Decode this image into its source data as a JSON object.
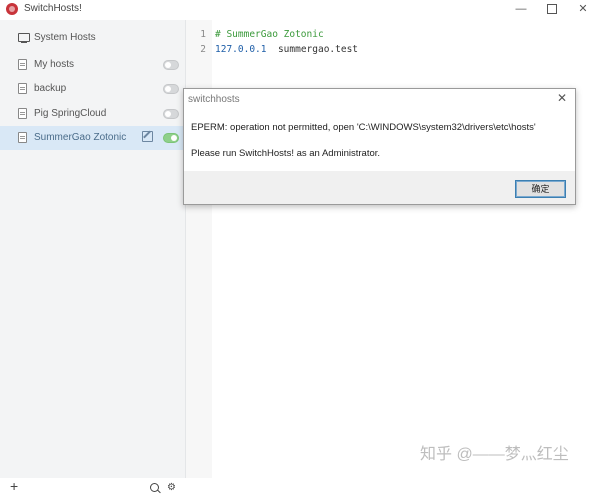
{
  "window": {
    "title": "SwitchHosts!",
    "minimize": "—",
    "close": "✕"
  },
  "sidebar": {
    "system_item": {
      "label": "System Hosts",
      "icon": "monitor-icon"
    },
    "items": [
      {
        "label": "My hosts",
        "enabled": false,
        "icon": "file-icon"
      },
      {
        "label": "backup",
        "enabled": false,
        "icon": "file-icon"
      },
      {
        "label": "Pig SpringCloud",
        "enabled": false,
        "icon": "file-icon"
      },
      {
        "label": "SummerGao Zotonic",
        "enabled": true,
        "icon": "file-icon",
        "active": true
      }
    ],
    "add_label": "+",
    "settings_label": "⚙"
  },
  "editor": {
    "lines": [
      {
        "number": "1",
        "text": "# SummerGao Zotonic"
      },
      {
        "number": "2",
        "ip": "127.0.0.1",
        "host": "summergao.test"
      }
    ]
  },
  "dialog": {
    "title": "switchhosts",
    "close": "✕",
    "message1": "EPERM: operation not permitted, open 'C:\\WINDOWS\\system32\\drivers\\etc\\hosts'",
    "message2": "Please run SwitchHosts! as an Administrator.",
    "ok_label": "确定"
  },
  "watermark": "知乎 @——梦灬红尘",
  "colors": {
    "active_bg": "#d9e8f6",
    "toggle_on": "#8fd08a",
    "comment": "#3c9a3c",
    "ip": "#1e5ea8"
  }
}
